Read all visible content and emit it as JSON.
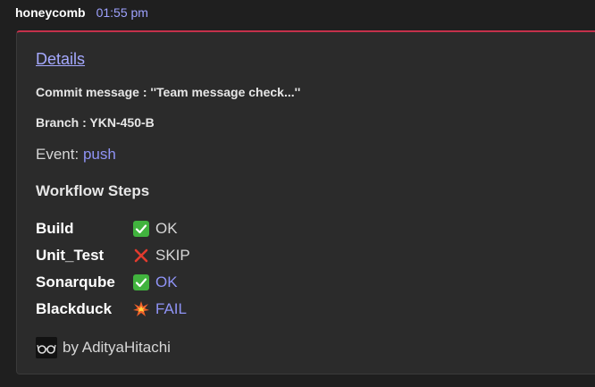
{
  "header": {
    "sender": "honeycomb",
    "time": "01:55 pm"
  },
  "card": {
    "accent_color": "#c4314b",
    "details_link": "Details",
    "commit_message": "Commit message : ''Team message check...''",
    "branch": "Branch : YKN-450-B",
    "event_label": "Event:",
    "event_value": "push",
    "steps_title": "Workflow Steps",
    "steps": [
      {
        "name": "Build",
        "status": "OK",
        "icon": "check-icon"
      },
      {
        "name": "Unit_Test",
        "status": "SKIP",
        "icon": "cross-icon"
      },
      {
        "name": "Sonarqube",
        "status": "OK",
        "icon": "check-icon"
      },
      {
        "name": "Blackduck",
        "status": "FAIL",
        "icon": "explosion-icon"
      }
    ],
    "footer_text": "by AdityaHitachi"
  }
}
